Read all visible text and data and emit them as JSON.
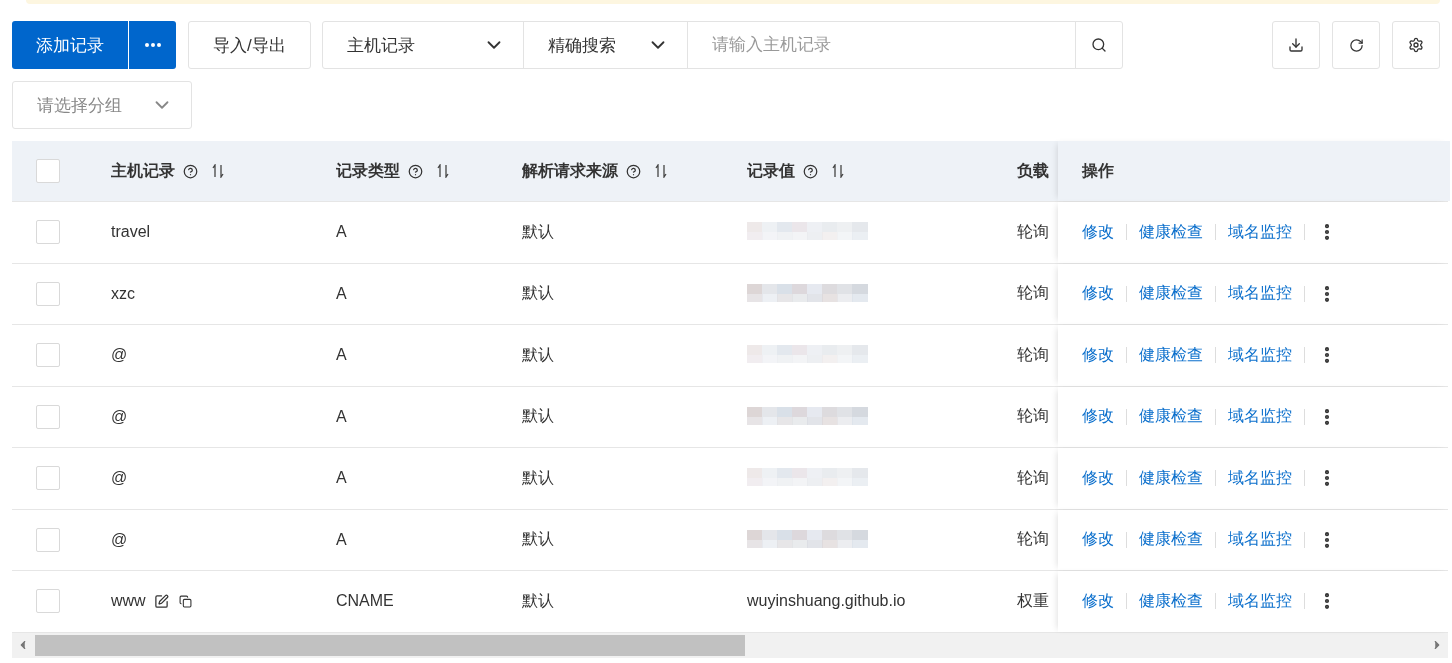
{
  "toolbar": {
    "add_button": "添加记录",
    "import_button": "导入/导出",
    "field_select": "主机记录",
    "match_select": "精确搜索",
    "search": {
      "placeholder": "请输入主机记录"
    },
    "group_select": {
      "placeholder": "请选择分组"
    }
  },
  "table": {
    "columns": [
      {
        "label": "主机记录",
        "help": true,
        "sortable": true
      },
      {
        "label": "记录类型",
        "help": true,
        "sortable": true
      },
      {
        "label": "解析请求来源",
        "help": true,
        "sortable": true
      },
      {
        "label": "记录值",
        "help": true,
        "sortable": true
      },
      {
        "label": "负载"
      },
      {
        "label": "操作"
      }
    ],
    "select_all_checked": false,
    "rows": [
      {
        "checked": false,
        "host": "travel",
        "editable": false,
        "type": "A",
        "source": "默认",
        "value": {
          "kind": "blurred"
        },
        "balance": "轮询",
        "actions": [
          "修改",
          "健康检查",
          "域名监控"
        ]
      },
      {
        "checked": false,
        "host": "xzc",
        "editable": false,
        "type": "A",
        "source": "默认",
        "value": {
          "kind": "blurred"
        },
        "balance": "轮询",
        "actions": [
          "修改",
          "健康检查",
          "域名监控"
        ]
      },
      {
        "checked": false,
        "host": "@",
        "editable": false,
        "type": "A",
        "source": "默认",
        "value": {
          "kind": "blurred"
        },
        "balance": "轮询",
        "actions": [
          "修改",
          "健康检查",
          "域名监控"
        ]
      },
      {
        "checked": false,
        "host": "@",
        "editable": false,
        "type": "A",
        "source": "默认",
        "value": {
          "kind": "blurred"
        },
        "balance": "轮询",
        "actions": [
          "修改",
          "健康检查",
          "域名监控"
        ]
      },
      {
        "checked": false,
        "host": "@",
        "editable": false,
        "type": "A",
        "source": "默认",
        "value": {
          "kind": "blurred"
        },
        "balance": "轮询",
        "actions": [
          "修改",
          "健康检查",
          "域名监控"
        ]
      },
      {
        "checked": false,
        "host": "@",
        "editable": false,
        "type": "A",
        "source": "默认",
        "value": {
          "kind": "blurred"
        },
        "balance": "轮询",
        "actions": [
          "修改",
          "健康检查",
          "域名监控"
        ]
      },
      {
        "checked": false,
        "host": "www",
        "editable": true,
        "type": "CNAME",
        "source": "默认",
        "value": {
          "kind": "text",
          "text": "wuyinshuang.github.io"
        },
        "balance": "权重",
        "actions": [
          "修改",
          "健康检查",
          "域名监控"
        ]
      }
    ]
  }
}
